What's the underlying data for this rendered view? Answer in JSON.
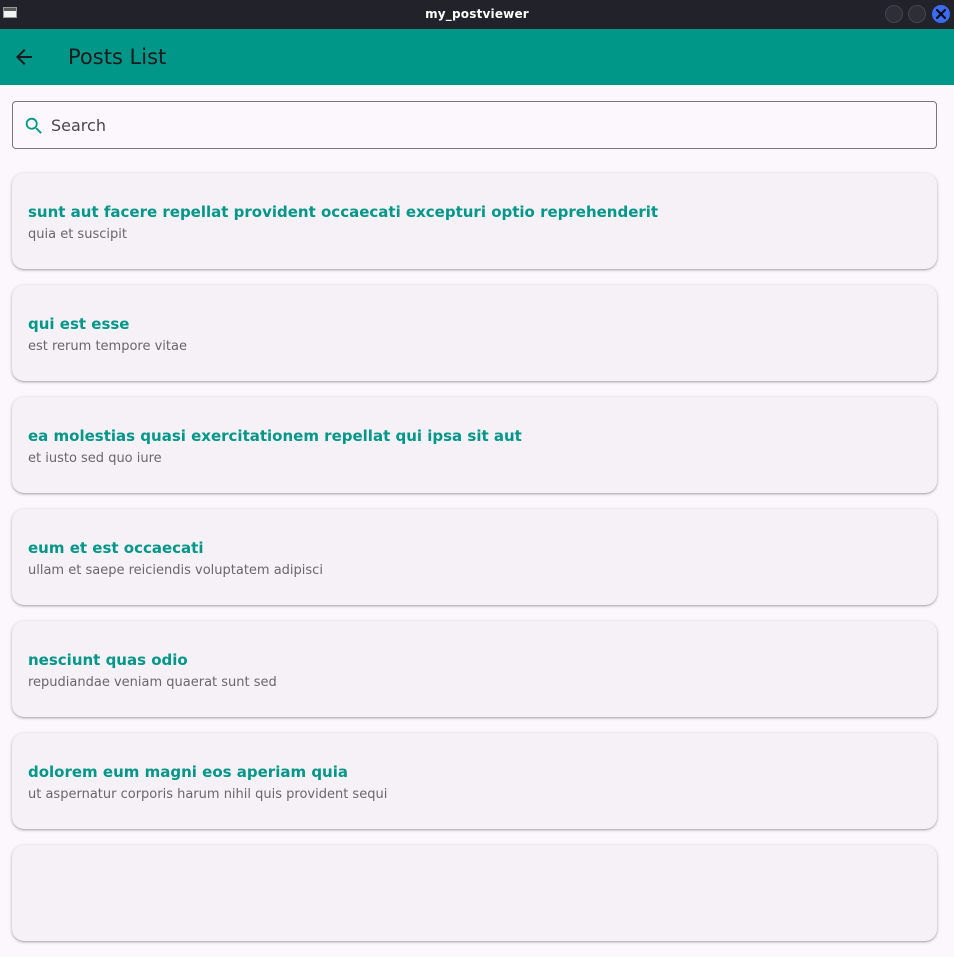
{
  "window": {
    "title": "my_postviewer"
  },
  "appbar": {
    "title": "Posts List",
    "back_icon": "arrow-back-icon"
  },
  "search": {
    "placeholder": "Search",
    "value": "",
    "icon": "search-icon"
  },
  "posts": [
    {
      "title": "sunt aut facere repellat provident occaecati excepturi optio reprehenderit",
      "subtitle": "quia et suscipit"
    },
    {
      "title": "qui est esse",
      "subtitle": "est rerum tempore vitae"
    },
    {
      "title": "ea molestias quasi exercitationem repellat qui ipsa sit aut",
      "subtitle": "et iusto sed quo iure"
    },
    {
      "title": "eum et est occaecati",
      "subtitle": "ullam et saepe reiciendis voluptatem adipisci"
    },
    {
      "title": "nesciunt quas odio",
      "subtitle": "repudiandae veniam quaerat sunt sed"
    },
    {
      "title": "dolorem eum magni eos aperiam quia",
      "subtitle": "ut aspernatur corporis harum nihil quis provident sequi"
    },
    {
      "title": "",
      "subtitle": ""
    }
  ],
  "colors": {
    "appbar": "#009688",
    "accent": "#009688",
    "background": "#fcf7fc",
    "card": "#f6f1f7",
    "titlebar": "#22222a",
    "close_button": "#3b6cf0"
  }
}
